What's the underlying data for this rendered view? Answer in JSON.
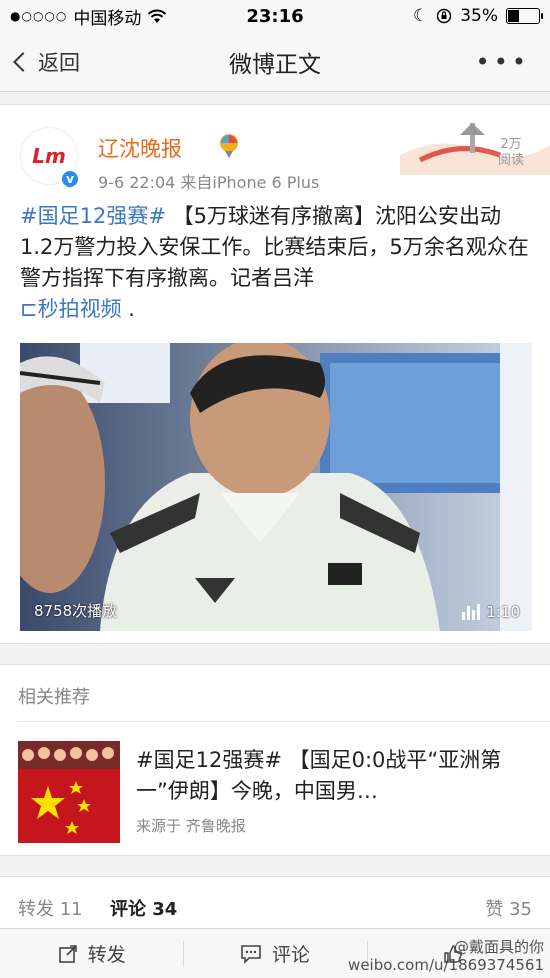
{
  "status_bar": {
    "signal": "●○○○○",
    "carrier": "中国移动",
    "time": "23:16",
    "battery": "35%",
    "battery_level": 0.35
  },
  "nav": {
    "back_label": "返回",
    "title": "微博正文",
    "more": "•••"
  },
  "post": {
    "author": "辽沈晚报",
    "avatar_text": "Lm",
    "verified_mark": "v",
    "meta": "9-6 22:04  来自iPhone 6 Plus",
    "read_count": "2万",
    "read_label": "阅读",
    "hashtag": "#国足12强赛#",
    "body": " 【5万球迷有序撤离】沈阳公安出动1.2万警力投入安保工作。比赛结束后，5万余名观众在警方指挥下有序撤离。记者吕洋",
    "video_link_icon": "⊏",
    "video_link": "秒拍视频",
    "trailing": " .",
    "video": {
      "play_count": "8758次播放",
      "duration": "1:10"
    }
  },
  "related": {
    "heading": "相关推荐",
    "item": {
      "title": "#国足12强赛# 【国足0:0战平“亚洲第一”伊朗】今晚，中国男…",
      "source": "来源于 齐鲁晚报"
    }
  },
  "tabs": {
    "repost": "转发 11",
    "comment": "评论 34",
    "like": "赞 35"
  },
  "toolbar": {
    "repost": "转发",
    "comment": "评论",
    "like": ""
  },
  "watermark": {
    "line1": "@戴面具的你",
    "line2": "weibo.com/u/1869374561"
  },
  "colors": {
    "accent_blue": "#3b78c4",
    "author_orange": "#e86b1c"
  }
}
